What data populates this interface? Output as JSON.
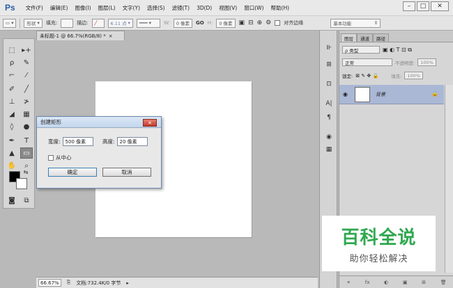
{
  "app": {
    "logo": "Ps"
  },
  "menu": [
    "文件(F)",
    "编辑(E)",
    "图像(I)",
    "图层(L)",
    "文字(Y)",
    "选择(S)",
    "滤镜(T)",
    "3D(D)",
    "视图(V)",
    "窗口(W)",
    "帮助(H)"
  ],
  "window_controls": {
    "minimize": "–",
    "restore": "□",
    "close": "✕"
  },
  "options": {
    "shape_mode": "形状",
    "fill_label": "填充:",
    "stroke_label": "描边:",
    "stroke_width": "6.11 点",
    "w_label": "W:",
    "w_value": "0 像素",
    "link": "GO",
    "h_label": "H:",
    "h_value": "0 像素",
    "align_edges_label": "对齐边缘",
    "workspace": "基本功能"
  },
  "document": {
    "tab_title": "未标题-1 @ 66.7%(RGB/8) *",
    "tab_close": "×",
    "zoom": "66.67%",
    "doc_info": "文档:732.4K/0 字节"
  },
  "dialog": {
    "title": "创建矩形",
    "close": "✕",
    "width_label": "宽度:",
    "width_value": "500 像素",
    "height_label": "高度:",
    "height_value": "20 像素",
    "from_center_label": "从中心",
    "ok_label": "确定",
    "cancel_label": "取消"
  },
  "layers_panel": {
    "tabs": [
      "图层",
      "通道",
      "路径"
    ],
    "kind_filter": "ρ 类型",
    "blend_mode": "正常",
    "opacity_label": "不透明度:",
    "opacity_value": "100%",
    "lock_label": "锁定:",
    "fill_label": "填充:",
    "fill_value": "100%",
    "layer_name": "背景",
    "bottom_icons": [
      "fx",
      "◐",
      "▣",
      "⊞",
      "🗑"
    ]
  },
  "watermark": {
    "title": "百科全说",
    "subtitle": "助你轻松解决"
  },
  "colors": {
    "accent": "#2a5ca8",
    "layer_selected": "#aab8d6",
    "watermark_green": "#2fa84f"
  }
}
